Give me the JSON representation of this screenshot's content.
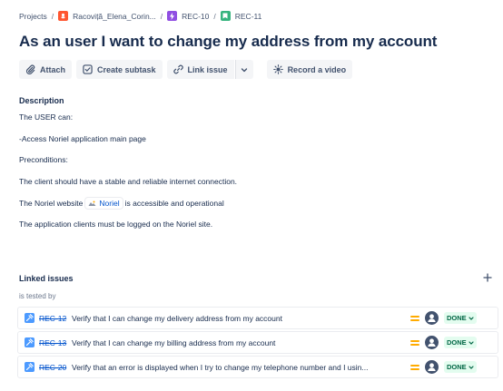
{
  "breadcrumb": {
    "projects": "Projects",
    "project": "Racoviță_Elena_Corin...",
    "epic": "REC-10",
    "story": "REC-11"
  },
  "issue": {
    "title": "As an user I want to change my address from my account"
  },
  "toolbar": {
    "attach": "Attach",
    "create_subtask": "Create subtask",
    "link_issue": "Link issue",
    "record_video": "Record a video"
  },
  "description": {
    "label": "Description",
    "line1": "The USER can:",
    "line2": "-Access Noriel application main page",
    "line3": "Preconditions:",
    "line4": "The client should have a stable and reliable internet connection.",
    "line5_before": "The Noriel website",
    "line5_link": "Noriel",
    "line5_after": "is accessible and operational",
    "line6": "The application clients must be logged  on the Noriel site."
  },
  "linked_issues": {
    "label": "Linked issues",
    "relation": "is tested by",
    "items": [
      {
        "key": "REC-12",
        "summary": "Verify that I can change my delivery address from my account",
        "status": "DONE",
        "priority_icon": "medium-priority-icon"
      },
      {
        "key": "REC-13",
        "summary": "Verify that I can change my billing address from my account",
        "status": "DONE",
        "priority_icon": "medium-priority-icon"
      },
      {
        "key": "REC-20",
        "summary": "Verify that an error is displayed when I try to change my telephone number and I usin...",
        "status": "DONE",
        "priority_icon": "medium-priority-icon"
      }
    ]
  },
  "colors": {
    "link": "#0052cc",
    "done_bg": "#e3fcef",
    "done_text": "#006644",
    "priority": "#ffab00",
    "test_issue_type": "#4c9aff"
  }
}
